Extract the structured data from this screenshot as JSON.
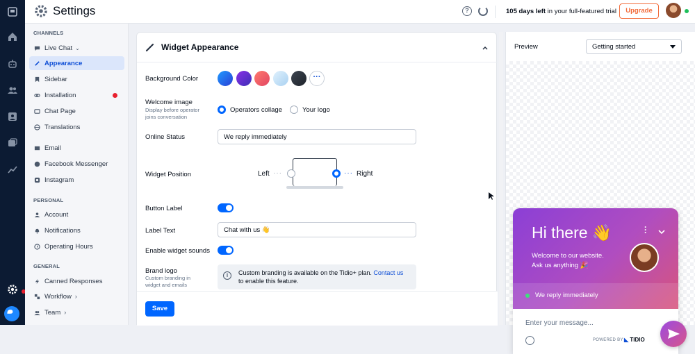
{
  "header": {
    "title": "Settings",
    "trial_days": "105 days left",
    "trial_rest": " in your full-featured trial",
    "upgrade_label": "Upgrade"
  },
  "sidebar": {
    "channels_heading": "CHANNELS",
    "live_chat": "Live Chat",
    "appearance": "Appearance",
    "sidebar_item": "Sidebar",
    "installation": "Installation",
    "chat_page": "Chat Page",
    "translations": "Translations",
    "email": "Email",
    "facebook": "Facebook Messenger",
    "instagram": "Instagram",
    "personal_heading": "PERSONAL",
    "account": "Account",
    "notifications": "Notifications",
    "operating_hours": "Operating Hours",
    "general_heading": "GENERAL",
    "canned": "Canned Responses",
    "workflow": "Workflow",
    "team": "Team"
  },
  "card": {
    "title": "Widget Appearance",
    "background_color_label": "Background Color",
    "welcome_image_label": "Welcome image",
    "welcome_image_sub1": "Display before operator",
    "welcome_image_sub2": "joins conversation",
    "opt_collage": "Operators collage",
    "opt_logo": "Your logo",
    "online_status_label": "Online Status",
    "online_status_value": "We reply immediately",
    "widget_position_label": "Widget Position",
    "pos_left": "Left",
    "pos_right": "Right",
    "button_label_label": "Button Label",
    "label_text_label": "Label Text",
    "label_text_value": "Chat with us 👋",
    "sounds_label": "Enable widget sounds",
    "brand_logo_label": "Brand logo",
    "brand_logo_sub1": "Custom branding in",
    "brand_logo_sub2": "widget and emails",
    "brand_info_text": "Custom branding is available on the Tidio+ plan. ",
    "brand_info_link": "Contact us",
    "brand_info_text2": "to enable this feature.",
    "save_label": "Save"
  },
  "swatch_colors": [
    "#2f6df0",
    "#6a2fd6",
    "#ef5a5a",
    "#c7e3f7",
    "#2b3138"
  ],
  "preview": {
    "label": "Preview",
    "select_value": "Getting started",
    "greeting": "Hi there 👋",
    "welcome1": "Welcome to our website.",
    "welcome2": "Ask us anything 🎉",
    "status": "We reply immediately",
    "input_placeholder": "Enter your message...",
    "powered": "POWERED BY",
    "brand": "TIDIO"
  }
}
